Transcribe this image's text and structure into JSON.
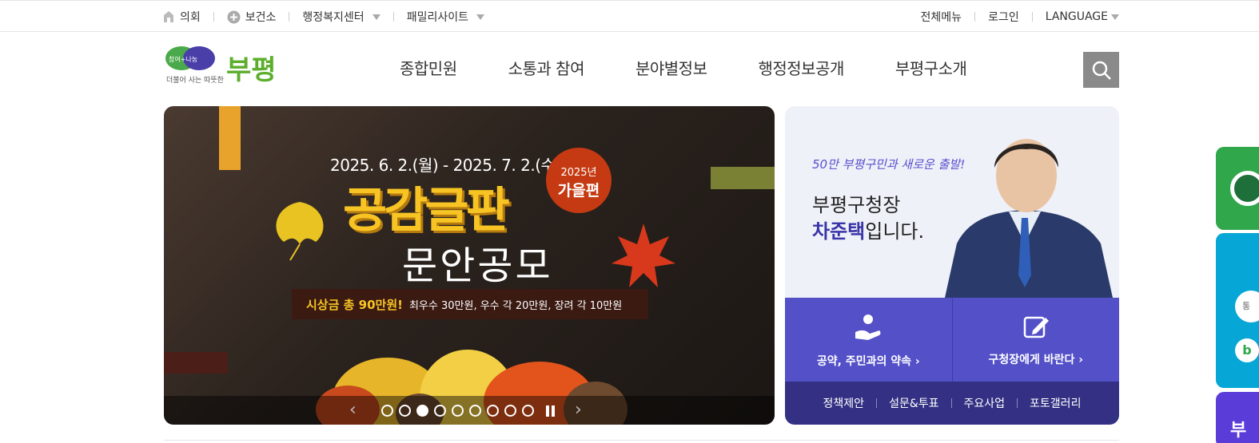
{
  "topbar": {
    "left": [
      {
        "label": "의회",
        "icon": "council-icon"
      },
      {
        "label": "보건소",
        "icon": "plus-circle-icon"
      },
      {
        "label": "행정복지센터",
        "icon": "caret-down-icon"
      },
      {
        "label": "패밀리사이트",
        "icon": "caret-down-icon"
      }
    ],
    "right": [
      {
        "label": "전체메뉴"
      },
      {
        "label": "로그인"
      },
      {
        "label": "LANGUAGE"
      }
    ]
  },
  "logo": {
    "slogan_top": "참여+나눔",
    "slogan_bottom": "더불어 사는 따뜻한",
    "name": "부평"
  },
  "gnb": [
    "종합민원",
    "소통과 참여",
    "분야별정보",
    "행정정보공개",
    "부평구소개"
  ],
  "banner": {
    "date": "2025. 6. 2.(월) - 2025. 7. 2.(수)",
    "badge_year": "2025년",
    "badge_season": "가을편",
    "title1": "공감글판",
    "title2": "문안공모",
    "prize_highlight": "시상금 총 90만원!",
    "prize_detail": "최우수 30만원, 우수 각 20만원, 장려 각 10만원",
    "slide_count": 9,
    "active_slide": 3,
    "prev_icon": "‹",
    "next_icon": "›"
  },
  "mayor": {
    "slogan": "50만 부평구민과 새로운 출발!",
    "title": "부평구청장",
    "name": "차준택",
    "name_suffix": "입니다.",
    "buttons": [
      {
        "label": "공약, 주민과의 약속",
        "icon": "pledge-hand-icon"
      },
      {
        "label": "구청장에게 바란다",
        "icon": "pen-icon"
      }
    ],
    "links": [
      "정책제안",
      "설문&투표",
      "주요사업",
      "포토갤러리"
    ],
    "chevron": "›"
  },
  "quick": {
    "q2_label": "통",
    "q2_b": "b",
    "q3_label": "부"
  }
}
